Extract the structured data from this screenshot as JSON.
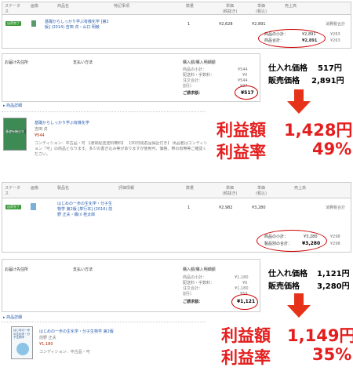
{
  "screen1": {
    "headers": [
      "ステータス",
      "画像",
      "商品名",
      "特記事項",
      "数量",
      "単価\n(税抜き)",
      "単価\n(税込)",
      "売上高"
    ],
    "status_badge": "出荷完了",
    "product_title": "基礎からしっかり学ぶ有機化学 [第2版] (2014) 吉田 貞・山口 明敏",
    "quantity": "1",
    "unit_price_ex": "¥2,628",
    "unit_price_in": "¥2,891",
    "sales_note": "消費税合計",
    "sales_lines": [
      {
        "label": "商品の小計：",
        "value": "¥2,891",
        "tax": "¥263"
      },
      {
        "label": "商品合計：",
        "value": "¥2,891",
        "tax": "¥263"
      }
    ],
    "address_label": "お届け先住所",
    "payment_label": "支払い方法",
    "breakdown_title": "購入額/購入明細額",
    "breakdown": [
      {
        "label": "商品の小計：",
        "value": "¥544"
      },
      {
        "label": "配送料・手数料：",
        "value": "¥0"
      },
      {
        "label": "注文合計：",
        "value": "¥544"
      },
      {
        "label": "割引：",
        "value": "¥27"
      }
    ],
    "total_label": "ご請求額：",
    "total_value": "¥517",
    "more_link": "▸ 商品詳細",
    "cover_title": "基礎有機化学",
    "item_title": "基礎からしっかり学ぶ有機化学",
    "item_author": "吉田 貞",
    "item_price": "¥544",
    "item_desc": "コンディション：中古品・可 【通常配送送料無料】 【30日間返品保証付き】 出品者はコンディション「可」の商品となります。多少の書き込み等がありますが使用可、価格、帯の有無等ご確認ください。",
    "purchase_label": "仕入れ価格",
    "purchase_value": "517円",
    "sale_label": "販売価格",
    "sale_value": "2,891円",
    "profit_label": "利益額",
    "profit_value": "1,428円",
    "rate_label": "利益率",
    "rate_value": "49%"
  },
  "screen2": {
    "headers": [
      "ステータス",
      "画像",
      "製品名",
      "評価情報",
      "数量",
      "単価\n(税抜き)",
      "単価\n(税込)",
      "売上高"
    ],
    "status_badge": "出荷完了",
    "product_title": "はじめの一歩の生化学・分子生物学 第2版 [単行本] (2016) 前野 正夫・磯川 桂太郎",
    "quantity": "1",
    "unit_price_ex": "¥2,982",
    "unit_price_in": "¥3,280",
    "sales_note": "消費税合計",
    "sales_lines": [
      {
        "label": "商品の小計：",
        "value": "¥3,280",
        "tax": "¥298"
      },
      {
        "label": "製品別の合計：",
        "value": "¥3,280",
        "tax": "¥298"
      }
    ],
    "address_label": "お届け先住所",
    "payment_label": "支払い方法",
    "breakdown_title": "購入額/購入明細額",
    "breakdown": [
      {
        "label": "商品の小計：",
        "value": "¥1,180"
      },
      {
        "label": "配送料・手数料：",
        "value": "¥0"
      },
      {
        "label": "注文合計：",
        "value": "¥1,180"
      },
      {
        "label": "割引：",
        "value": "¥59"
      }
    ],
    "total_label": "ご請求額：",
    "total_value": "¥1,121",
    "more_link": "▸ 商品詳細",
    "cover_title": "はじめの一歩の生化学・分子生物学",
    "item_title": "はじめの一歩の生化学・分子生物学 第2版",
    "item_author": "前野 正夫",
    "item_price": "¥1,180",
    "item_desc": "コンディション：中古品・可",
    "purchase_label": "仕入れ価格",
    "purchase_value": "1,121円",
    "sale_label": "販売価格",
    "sale_value": "3,280円",
    "profit_label": "利益額",
    "profit_value": "1,149円",
    "rate_label": "利益率",
    "rate_value": "35%"
  },
  "colors": {
    "accent_red": "#e41e1e",
    "ellipse_red": "#cc0000",
    "badge_green": "#3c9a3c",
    "link_blue": "#2a5db0",
    "arrow": "#e63219"
  }
}
